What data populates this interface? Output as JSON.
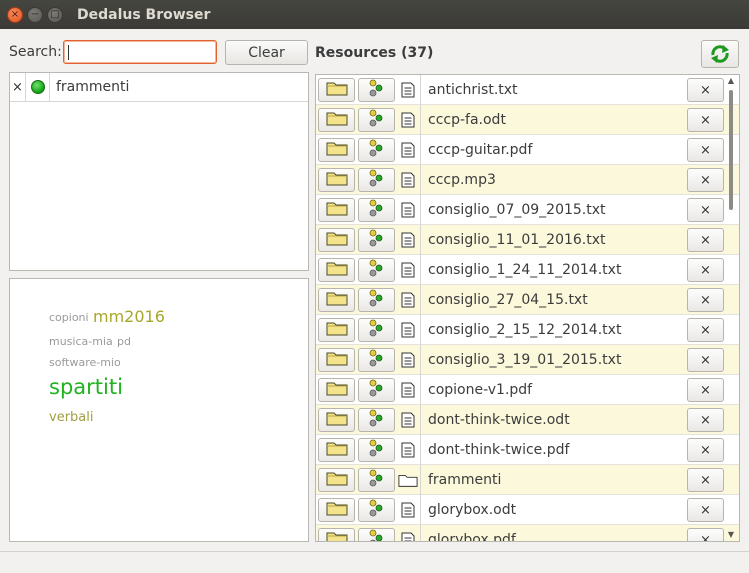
{
  "window": {
    "title": "Dedalus Browser",
    "controls": {
      "close": "×",
      "minimize": "−",
      "maximize": "□"
    }
  },
  "search": {
    "label": "Search:",
    "value": "",
    "clear_label": "Clear"
  },
  "filters": [
    {
      "remove": "×",
      "status_color": "#18a818",
      "name": "frammenti"
    }
  ],
  "tag_cloud": [
    {
      "text": "copioni",
      "color": "#9a9a9a"
    },
    {
      "text": "mm2016",
      "color": "#a7a72a"
    },
    {
      "text": "musica-mia",
      "color": "#9a9a9a"
    },
    {
      "text": "pd",
      "color": "#9a9a9a"
    },
    {
      "text": "software-mio",
      "color": "#9a9a9a"
    },
    {
      "text": "spartiti",
      "color": "#1fb31f"
    },
    {
      "text": "verbali",
      "color": "#a0a040"
    }
  ],
  "resources": {
    "title": "Resources (37)",
    "remove_label": "×",
    "items": [
      {
        "name": "antichrist.txt",
        "type": "file-icon"
      },
      {
        "name": "cccp-fa.odt",
        "type": "file-icon"
      },
      {
        "name": "cccp-guitar.pdf",
        "type": "file-icon"
      },
      {
        "name": "cccp.mp3",
        "type": "file-icon"
      },
      {
        "name": "consiglio_07_09_2015.txt",
        "type": "file-icon"
      },
      {
        "name": "consiglio_11_01_2016.txt",
        "type": "file-icon"
      },
      {
        "name": "consiglio_1_24_11_2014.txt",
        "type": "file-icon"
      },
      {
        "name": "consiglio_27_04_15.txt",
        "type": "file-icon"
      },
      {
        "name": "consiglio_2_15_12_2014.txt",
        "type": "file-icon"
      },
      {
        "name": "consiglio_3_19_01_2015.txt",
        "type": "file-icon"
      },
      {
        "name": "copione-v1.pdf",
        "type": "file-icon"
      },
      {
        "name": "dont-think-twice.odt",
        "type": "file-icon"
      },
      {
        "name": "dont-think-twice.pdf",
        "type": "file-icon"
      },
      {
        "name": "frammenti",
        "type": "folder-outline-icon"
      },
      {
        "name": "glorybox.odt",
        "type": "file-icon"
      },
      {
        "name": "glorybox.pdf",
        "type": "file-icon"
      }
    ]
  },
  "colors": {
    "accent": "#e0632f",
    "alt_row": "#fcf8dc",
    "titlebar": "#3c3b37"
  }
}
